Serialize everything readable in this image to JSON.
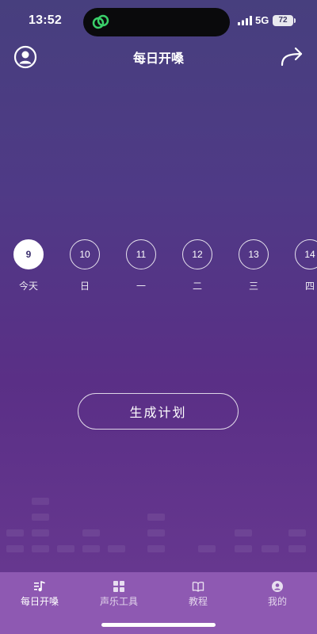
{
  "status_bar": {
    "time": "13:52",
    "network": "5G",
    "battery": "72",
    "island_icon": "link-rings-icon"
  },
  "header": {
    "title": "每日开嗓",
    "left_icon": "user-avatar-icon",
    "right_icon": "share-arrow-icon"
  },
  "date_strip": {
    "dates": [
      {
        "day": "9",
        "weekday": "今天",
        "selected": true
      },
      {
        "day": "10",
        "weekday": "日",
        "selected": false
      },
      {
        "day": "11",
        "weekday": "一",
        "selected": false
      },
      {
        "day": "12",
        "weekday": "二",
        "selected": false
      },
      {
        "day": "13",
        "weekday": "三",
        "selected": false
      },
      {
        "day": "14",
        "weekday": "四",
        "selected": false
      }
    ]
  },
  "main": {
    "generate_plan_label": "生成计划"
  },
  "tab_bar": {
    "tabs": [
      {
        "label": "每日开嗓",
        "icon": "music-note-icon",
        "active": true
      },
      {
        "label": "声乐工具",
        "icon": "grid-icon",
        "active": false
      },
      {
        "label": "教程",
        "icon": "book-icon",
        "active": false
      },
      {
        "label": "我的",
        "icon": "profile-icon",
        "active": false
      }
    ]
  },
  "colors": {
    "background_top": "#473f7e",
    "background_bottom": "#6a3a92",
    "tab_bar": "#8e59b2",
    "selected_date_fill": "#ffffff"
  }
}
